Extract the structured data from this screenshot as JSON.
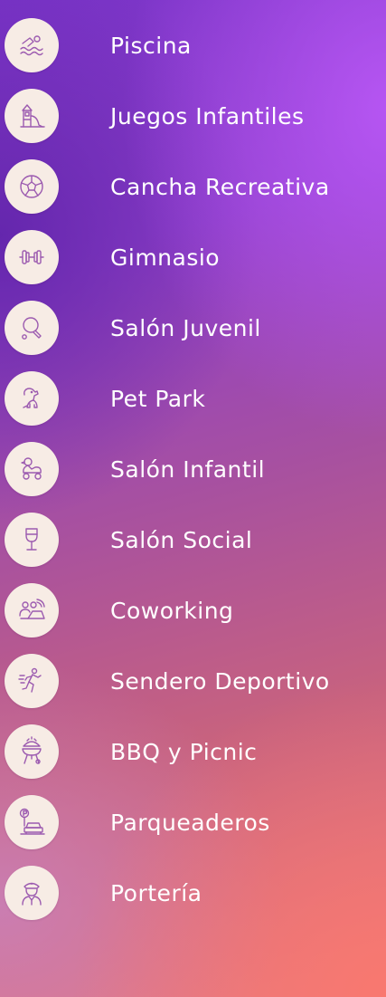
{
  "amenities": [
    {
      "label": "Piscina",
      "icon": "swimmer-icon"
    },
    {
      "label": "Juegos Infantiles",
      "icon": "playground-icon"
    },
    {
      "label": "Cancha Recreativa",
      "icon": "soccer-ball-icon"
    },
    {
      "label": "Gimnasio",
      "icon": "dumbbell-icon"
    },
    {
      "label": "Salón Juvenil",
      "icon": "ping-pong-icon"
    },
    {
      "label": "Pet Park",
      "icon": "dog-icon"
    },
    {
      "label": "Salón Infantil",
      "icon": "toy-duck-icon"
    },
    {
      "label": "Salón Social",
      "icon": "wine-glass-icon"
    },
    {
      "label": "Coworking",
      "icon": "coworking-laptop-icon"
    },
    {
      "label": "Sendero Deportivo",
      "icon": "runner-icon"
    },
    {
      "label": "BBQ y Picnic",
      "icon": "grill-icon"
    },
    {
      "label": "Parqueaderos",
      "icon": "parking-car-icon"
    },
    {
      "label": "Portería",
      "icon": "security-guard-icon"
    }
  ],
  "colors": {
    "icon_background": "#f7ece5",
    "icon_stroke": "#9c5bb0",
    "label_text": "#ffffff"
  }
}
